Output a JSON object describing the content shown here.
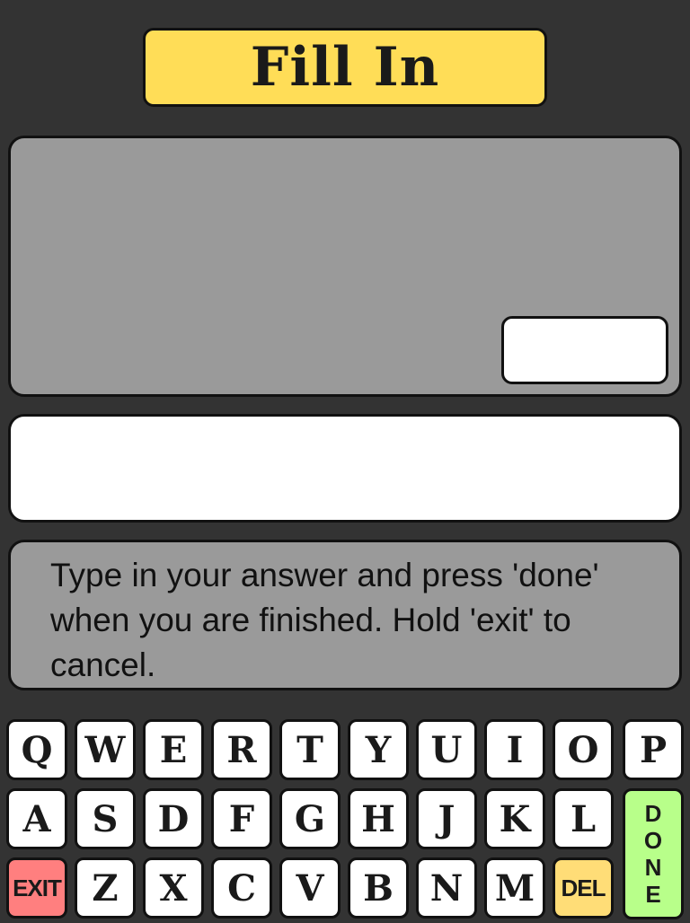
{
  "header": {
    "title": "Fill In"
  },
  "instructions": {
    "text": "Type in your answer and press 'done' when you are finished. Hold 'exit' to cancel."
  },
  "keyboard": {
    "row1": [
      "Q",
      "W",
      "E",
      "R",
      "T",
      "Y",
      "U",
      "I",
      "O",
      "P"
    ],
    "row2": [
      "A",
      "S",
      "D",
      "F",
      "G",
      "H",
      "J",
      "K",
      "L"
    ],
    "row3": [
      "Z",
      "X",
      "C",
      "V",
      "B",
      "N",
      "M"
    ],
    "exit_label": "EXIT",
    "del_label": "DEL",
    "done_letters": [
      "D",
      "O",
      "N",
      "E"
    ]
  },
  "colors": {
    "background": "#333333",
    "title_banner": "#ffdd57",
    "panel_gray": "#9a9a9a",
    "exit_key": "#ff7f7f",
    "del_key": "#ffdd77",
    "done_key": "#b8ff8a"
  }
}
